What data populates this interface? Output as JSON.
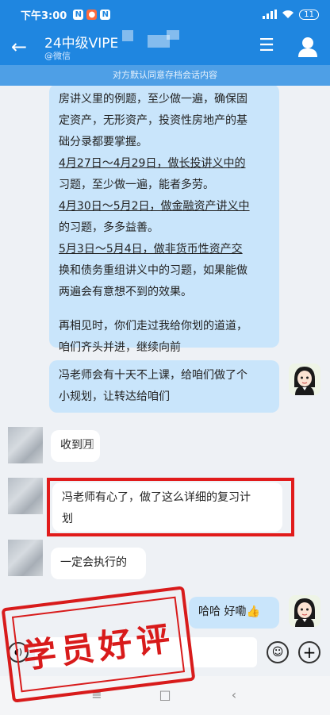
{
  "status_bar": {
    "time": "下午3:00",
    "notifications": [
      "N",
      "●",
      "N"
    ],
    "battery": "11"
  },
  "header": {
    "title": "24中级VIPE",
    "subtitle": "@微信",
    "notice": "对方默认同意存档会话内容"
  },
  "messages": [
    {
      "side": "out",
      "lines": [
        "房讲义里的例题，至少做一遍，确保固",
        "定资产，无形资产，投资性房地产的基",
        "础分录都要掌握。",
        "4月27日～4月29日，做长投讲义中的",
        "习题，至少做一遍，能者多劳。",
        "4月30日～5月2日，做金融资产讲义中",
        "的习题，多多益善。",
        "5月3日～5月4日，做非货币性资产交",
        "换和债务重组讲义中的习题，如果能做",
        "两遍会有意想不到的效果。",
        "",
        "再相见时，你们走过我给你划的道道，",
        "咱们齐头并进，继续向前"
      ]
    },
    {
      "side": "out",
      "lines": [
        "冯老师会有十天不上课，给咱们做了个",
        "小规划，让转达给咱们"
      ]
    },
    {
      "side": "in",
      "lines": [
        "收到🈷"
      ]
    },
    {
      "side": "in",
      "lines": [
        "冯老师有心了，做了这么详细的复习计",
        "划"
      ]
    },
    {
      "side": "in",
      "lines": [
        "一定会执行的"
      ]
    },
    {
      "side": "out",
      "lines": [
        "哈哈  好嘞👍"
      ]
    }
  ],
  "stamp": "学员好评",
  "nav": {
    "menu": "≡",
    "home": "□",
    "back": "‹"
  }
}
